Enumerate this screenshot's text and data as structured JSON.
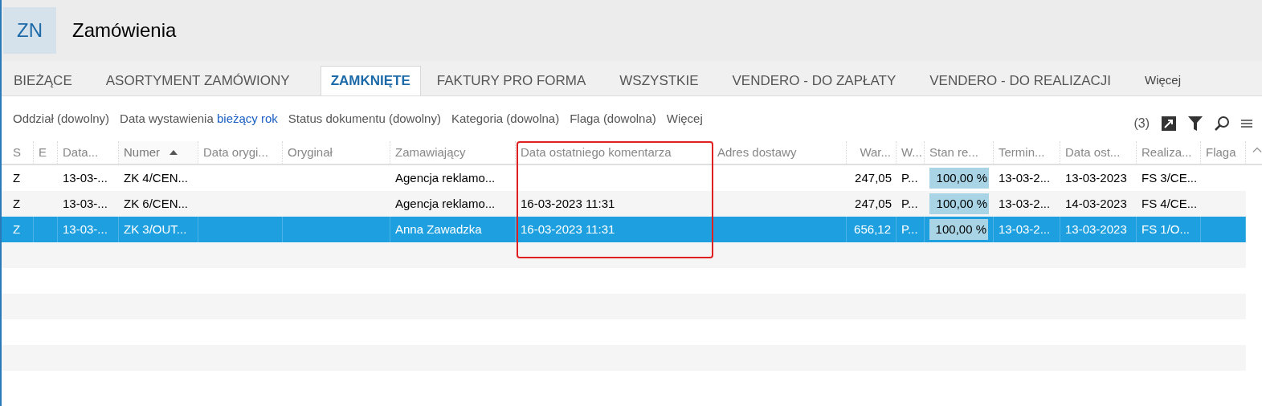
{
  "header": {
    "badge": "ZN",
    "title": "Zamówienia"
  },
  "tabs": [
    {
      "label": "BIEŻĄCE",
      "selected": false
    },
    {
      "label": "ASORTYMENT ZAMÓWIONY",
      "selected": false
    },
    {
      "label": "ZAMKNIĘTE",
      "selected": true
    },
    {
      "label": "FAKTURY PRO FORMA",
      "selected": false
    },
    {
      "label": "WSZYSTKIE",
      "selected": false
    },
    {
      "label": "VENDERO - DO ZAPŁATY",
      "selected": false
    },
    {
      "label": "VENDERO - DO REALIZACJI",
      "selected": false
    }
  ],
  "tabs_more": "Więcej",
  "filters": [
    {
      "label": "Oddział (dowolny)"
    },
    {
      "label": "Data wystawienia",
      "value": "bieżący rok"
    },
    {
      "label": "Status dokumentu (dowolny)"
    },
    {
      "label": "Kategoria (dowolna)"
    },
    {
      "label": "Flaga (dowolna)"
    },
    {
      "label": "Więcej"
    }
  ],
  "count": "(3)",
  "table": {
    "columns": [
      {
        "label": "S",
        "sorted": false,
        "highlighted": false
      },
      {
        "label": "E",
        "sorted": false,
        "highlighted": false
      },
      {
        "label": "Data...",
        "sorted": false,
        "highlighted": false
      },
      {
        "label": "Numer",
        "sorted": true,
        "highlighted": false
      },
      {
        "label": "Data orygi...",
        "sorted": false,
        "highlighted": false
      },
      {
        "label": "Oryginał",
        "sorted": false,
        "highlighted": false
      },
      {
        "label": "Zamawiający",
        "sorted": false,
        "highlighted": false
      },
      {
        "label": "Data ostatniego komentarza",
        "sorted": false,
        "highlighted": true
      },
      {
        "label": "Adres dostawy",
        "sorted": false,
        "highlighted": false
      },
      {
        "label": "War...",
        "sorted": false,
        "highlighted": false
      },
      {
        "label": "W...",
        "sorted": false,
        "highlighted": false
      },
      {
        "label": "Stan re...",
        "sorted": false,
        "highlighted": false
      },
      {
        "label": "Termin...",
        "sorted": false,
        "highlighted": false
      },
      {
        "label": "Data ost...",
        "sorted": false,
        "highlighted": false
      },
      {
        "label": "Realiza...",
        "sorted": false,
        "highlighted": false
      },
      {
        "label": "Flaga",
        "sorted": false,
        "highlighted": false
      }
    ],
    "rows": [
      {
        "selected": false,
        "cells": [
          "Z",
          "",
          "13-03-...",
          "ZK 4/CEN...",
          "",
          "",
          "Agencja reklamo...",
          "",
          "",
          "247,05",
          "P...",
          {
            "level": 1,
            "text": "100,00 %"
          },
          "13-03-2...",
          "13-03-2023",
          "FS 3/CE...",
          ""
        ]
      },
      {
        "selected": false,
        "cells": [
          "Z",
          "",
          "13-03-...",
          "ZK 6/CEN...",
          "",
          "",
          "Agencja reklamo...",
          "16-03-2023 11:31",
          "",
          "247,05",
          "P...",
          {
            "level": 1,
            "text": "100,00 %"
          },
          "13-03-2...",
          "14-03-2023",
          "FS 4/CE...",
          ""
        ]
      },
      {
        "selected": true,
        "cells": [
          "Z",
          "",
          "13-03-...",
          "ZK 3/OUT...",
          "",
          "",
          "Anna Zawadzka",
          "16-03-2023 11:31",
          "",
          "656,12",
          "P...",
          {
            "level": 1,
            "text": "100,00 %"
          },
          "13-03-2...",
          "13-03-2023",
          "FS 1/O...",
          ""
        ]
      }
    ]
  }
}
